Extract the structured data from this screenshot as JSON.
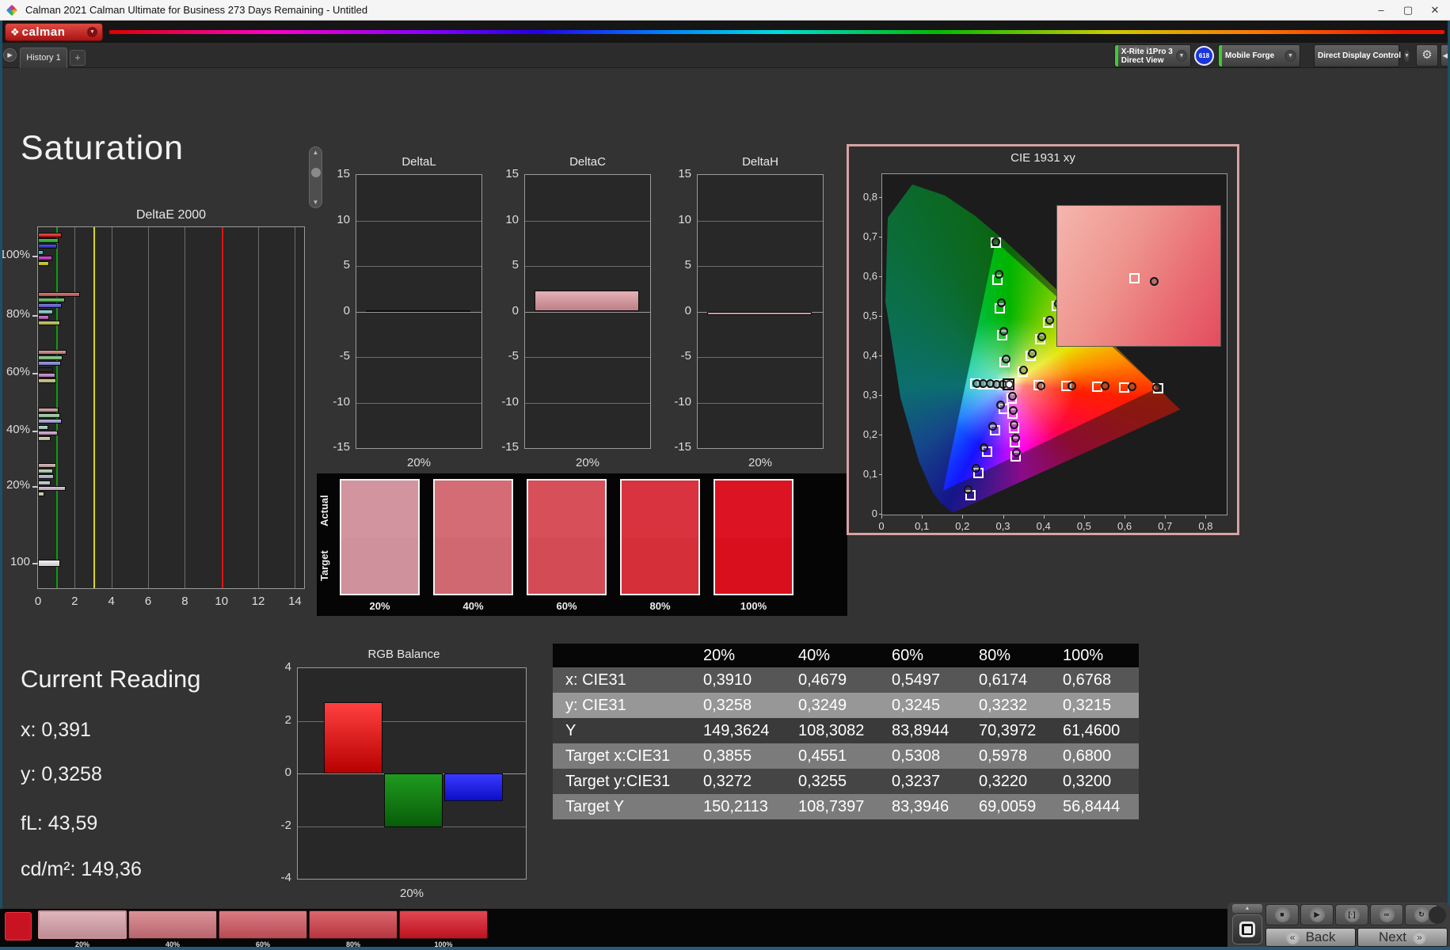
{
  "window": {
    "title": "Calman 2021 Calman Ultimate for Business 273 Days Remaining  - Untitled",
    "minimize": "–",
    "maximize": "▢",
    "close": "✕"
  },
  "brand": {
    "logo_text": "calman",
    "logo_glyph": "❖",
    "dropdown_glyph": "▼"
  },
  "tabs": {
    "history_tab": "History 1",
    "add_tab": "+",
    "play_glyph": "▶"
  },
  "devices": {
    "meter": {
      "line1": "X-Rite i1Pro 3",
      "line2": "Direct View",
      "accent": "#3ecc2e"
    },
    "badge": "618",
    "source": {
      "line1": "Mobile Forge",
      "line2": "",
      "accent": "#3ecc2e"
    },
    "display_control": {
      "line1": "Direct Display Control",
      "line2": "",
      "accent": "#d6d61e"
    },
    "gear_glyph": "⚙",
    "collapse_glyph": "◀"
  },
  "page": {
    "heading": "Saturation"
  },
  "current_reading": {
    "title": "Current Reading",
    "lines": [
      "x: 0,391",
      "y: 0,3258",
      "fL: 43,59",
      "cd/m²: 149,36"
    ]
  },
  "table": {
    "headers": [
      "",
      "20%",
      "40%",
      "60%",
      "80%",
      "100%"
    ],
    "rows": [
      {
        "label": "x: CIE31",
        "values": [
          "0,3910",
          "0,4679",
          "0,5497",
          "0,6174",
          "0,6768"
        ],
        "bg": "#565656"
      },
      {
        "label": "y: CIE31",
        "values": [
          "0,3258",
          "0,3249",
          "0,3245",
          "0,3232",
          "0,3215"
        ],
        "bg": "#979797"
      },
      {
        "label": "Y",
        "values": [
          "149,3624",
          "108,3082",
          "83,8944",
          "70,3972",
          "61,4600"
        ],
        "bg": "#3a3a3a"
      },
      {
        "label": "Target x:CIE31",
        "values": [
          "0,3855",
          "0,4551",
          "0,5308",
          "0,5978",
          "0,6800"
        ],
        "bg": "#7b7b7b"
      },
      {
        "label": "Target y:CIE31",
        "values": [
          "0,3272",
          "0,3255",
          "0,3237",
          "0,3220",
          "0,3200"
        ],
        "bg": "#454545"
      },
      {
        "label": "Target Y",
        "values": [
          "150,2113",
          "108,7397",
          "83,3946",
          "69,0059",
          "56,8444"
        ],
        "bg": "#7b7b7b"
      }
    ]
  },
  "swatches": {
    "actual_label": "Actual",
    "target_label": "Target",
    "labels": [
      "20%",
      "40%",
      "60%",
      "80%",
      "100%"
    ],
    "actual_colors": [
      "#d2959f",
      "#d36c75",
      "#d64f59",
      "#d8333e",
      "#dc1322"
    ],
    "target_colors": [
      "#cf919b",
      "#d06871",
      "#d34b55",
      "#d52f3a",
      "#d90f1e"
    ]
  },
  "bottom": {
    "chip_color": "#c81422",
    "thumb_labels": [
      "20%",
      "40%",
      "60%",
      "80%",
      "100%"
    ],
    "thumb_colors": [
      "#d8a0a9",
      "#d2737c",
      "#d05660",
      "#d03c46",
      "#d91423"
    ],
    "transport": {
      "up_glyph": "▲",
      "icons": [
        {
          "name": "stop-icon",
          "glyph": "■"
        },
        {
          "name": "play-icon",
          "glyph": "▶"
        },
        {
          "name": "interval-icon",
          "glyph": "[·]"
        },
        {
          "name": "continuous-icon",
          "glyph": "∞"
        },
        {
          "name": "refresh-icon",
          "glyph": "↻"
        }
      ],
      "back_label": "Back",
      "back_glyph": "«",
      "next_label": "Next",
      "next_glyph": "»"
    }
  },
  "chart_data": [
    {
      "id": "deltae2000",
      "type": "bar",
      "orientation": "horizontal",
      "title": "DeltaE 2000",
      "xticks": [
        0,
        2,
        4,
        6,
        8,
        10,
        12,
        14
      ],
      "xlim": [
        0,
        14.5
      ],
      "reference_lines": [
        {
          "value": 1,
          "color": "#0c9c0c"
        },
        {
          "value": 3,
          "color": "#d8d812"
        },
        {
          "value": 10,
          "color": "#e01010"
        }
      ],
      "groups": [
        {
          "label": "100%",
          "values": [
            1.3,
            1.12,
            1.02,
            0.29,
            0.76,
            0.61
          ],
          "colors": [
            "#e31b1b",
            "#1faf1f",
            "#2525dd",
            "#25c8c8",
            "#c623c6",
            "#c8c81e"
          ]
        },
        {
          "label": "80%",
          "values": [
            2.29,
            1.46,
            1.3,
            0.83,
            0.61,
            1.2
          ],
          "colors": [
            "#cf5555",
            "#52b852",
            "#5a5ad2",
            "#7cc8c8",
            "#bb5cbb",
            "#bcbc52"
          ]
        },
        {
          "label": "60%",
          "values": [
            1.56,
            1.34,
            1.24,
            0.83,
            0.93,
            0.98
          ],
          "colors": [
            "#cc7d7d",
            "#7fc47f",
            "#8585d0",
            "#96cccа",
            "#c484c4",
            "#c6c67e"
          ]
        },
        {
          "label": "40%",
          "values": [
            1.12,
            1.2,
            1.31,
            0.54,
            1.08,
            0.69
          ],
          "colors": [
            "#c99595",
            "#9ecb9e",
            "#a2a2d4",
            "#a8d0ce",
            "#c9a0c9",
            "#cdcd9c"
          ]
        },
        {
          "label": "20%",
          "values": [
            0.98,
            0.83,
            0.86,
            0.69,
            1.52,
            0.35
          ],
          "colors": [
            "#c9a8a8",
            "#b2ceb2",
            "#b4b4d6",
            "#b6d2d2",
            "#cfb4cf",
            "#d2d2b0"
          ]
        },
        {
          "label": "100",
          "values": [
            1.2
          ],
          "colors": [
            "#ececec"
          ]
        }
      ]
    },
    {
      "id": "deltaL",
      "type": "bar",
      "title": "DeltaL",
      "categories": [
        "20%"
      ],
      "values": [
        0.05
      ],
      "bar_color": "#111111",
      "ylim": [
        -15,
        15
      ],
      "yticks": [
        15,
        10,
        5,
        0,
        -5,
        -10,
        -15
      ]
    },
    {
      "id": "deltaC",
      "type": "bar",
      "title": "DeltaC",
      "categories": [
        "20%"
      ],
      "values": [
        2.3
      ],
      "bar_color": "#d89098",
      "ylim": [
        -15,
        15
      ],
      "yticks": [
        15,
        10,
        5,
        0,
        -5,
        -10,
        -15
      ]
    },
    {
      "id": "deltaH",
      "type": "bar",
      "title": "DeltaH",
      "categories": [
        "20%"
      ],
      "values": [
        -0.35
      ],
      "bar_color": "#d89098",
      "ylim": [
        -15,
        15
      ],
      "yticks": [
        15,
        10,
        5,
        0,
        -5,
        -10,
        -15
      ]
    },
    {
      "id": "cie",
      "type": "scatter",
      "title": "CIE 1931 xy",
      "xlim": [
        0,
        0.85
      ],
      "ylim": [
        0,
        0.86
      ],
      "xticks": [
        "0",
        "0,1",
        "0,2",
        "0,3",
        "0,4",
        "0,5",
        "0,6",
        "0,7",
        "0,8"
      ],
      "yticks": [
        "0,8",
        "0,7",
        "0,6",
        "0,5",
        "0,4",
        "0,3",
        "0,2",
        "0,1",
        "0"
      ],
      "white_point": [
        0.3127,
        0.329
      ],
      "triangle": [
        [
          0.68,
          0.32
        ],
        [
          0.28,
          0.69
        ],
        [
          0.15,
          0.06
        ]
      ],
      "locus": [
        [
          0.1741,
          0.005
        ],
        [
          0.144,
          0.0297
        ],
        [
          0.1241,
          0.0578
        ],
        [
          0.0913,
          0.1327
        ],
        [
          0.0454,
          0.295
        ],
        [
          0.0082,
          0.5384
        ],
        [
          0.0139,
          0.7502
        ],
        [
          0.0743,
          0.8338
        ],
        [
          0.1547,
          0.8059
        ],
        [
          0.2296,
          0.7543
        ],
        [
          0.3016,
          0.6923
        ],
        [
          0.3731,
          0.6245
        ],
        [
          0.4441,
          0.5547
        ],
        [
          0.5125,
          0.4866
        ],
        [
          0.5752,
          0.4242
        ],
        [
          0.627,
          0.3725
        ],
        [
          0.6915,
          0.3083
        ],
        [
          0.7347,
          0.2653
        ]
      ],
      "sweeps": [
        {
          "name": "red",
          "measured": [
            [
              0.391,
              0.3258
            ],
            [
              0.4679,
              0.3249
            ],
            [
              0.5497,
              0.3245
            ],
            [
              0.6174,
              0.3232
            ],
            [
              0.6768,
              0.3215
            ]
          ],
          "target": [
            [
              0.3855,
              0.3272
            ],
            [
              0.4551,
              0.3255
            ],
            [
              0.5308,
              0.3237
            ],
            [
              0.5978,
              0.322
            ],
            [
              0.68,
              0.32
            ]
          ]
        },
        {
          "name": "green",
          "measured": [
            [
              0.306,
              0.393
            ],
            [
              0.3,
              0.463
            ],
            [
              0.294,
              0.535
            ],
            [
              0.288,
              0.608
            ],
            [
              0.28,
              0.69
            ]
          ],
          "target": [
            [
              0.302,
              0.385
            ],
            [
              0.296,
              0.453
            ],
            [
              0.29,
              0.522
            ],
            [
              0.284,
              0.594
            ],
            [
              0.28,
              0.687
            ]
          ]
        },
        {
          "name": "blue",
          "measured": [
            [
              0.293,
              0.277
            ],
            [
              0.272,
              0.224
            ],
            [
              0.252,
              0.17
            ],
            [
              0.232,
              0.117
            ],
            [
              0.212,
              0.064
            ]
          ],
          "target": [
            [
              0.299,
              0.268
            ],
            [
              0.278,
              0.213
            ],
            [
              0.258,
              0.159
            ],
            [
              0.238,
              0.106
            ],
            [
              0.218,
              0.05
            ]
          ]
        },
        {
          "name": "cyan",
          "measured": [
            [
              0.298,
              0.33
            ],
            [
              0.282,
              0.33
            ],
            [
              0.266,
              0.3305
            ],
            [
              0.25,
              0.331
            ],
            [
              0.233,
              0.3315
            ]
          ],
          "target": [
            [
              0.296,
              0.329
            ],
            [
              0.28,
              0.329
            ],
            [
              0.264,
              0.3295
            ],
            [
              0.248,
              0.33
            ],
            [
              0.229,
              0.3305
            ]
          ]
        },
        {
          "name": "magenta",
          "measured": [
            [
              0.321,
              0.3
            ],
            [
              0.3235,
              0.264
            ],
            [
              0.326,
              0.228
            ],
            [
              0.3285,
              0.193
            ],
            [
              0.331,
              0.157
            ]
          ],
          "target": [
            [
              0.3195,
              0.293
            ],
            [
              0.322,
              0.256
            ],
            [
              0.3245,
              0.22
            ],
            [
              0.327,
              0.184
            ],
            [
              0.3295,
              0.148
            ]
          ]
        },
        {
          "name": "yellow",
          "measured": [
            [
              0.3495,
              0.366
            ],
            [
              0.3705,
              0.407
            ],
            [
              0.393,
              0.45
            ],
            [
              0.414,
              0.491
            ],
            [
              0.435,
              0.533
            ]
          ],
          "target": [
            [
              0.346,
              0.362
            ],
            [
              0.367,
              0.402
            ],
            [
              0.389,
              0.444
            ],
            [
              0.41,
              0.485
            ],
            [
              0.431,
              0.527
            ]
          ]
        }
      ]
    },
    {
      "id": "rgb_balance",
      "type": "bar",
      "title": "RGB Balance",
      "categories": [
        "20%"
      ],
      "ylim": [
        -4,
        4
      ],
      "yticks": [
        4,
        2,
        0,
        -2,
        -4
      ],
      "series": [
        {
          "name": "Red",
          "value": 2.7,
          "color_top": "#ff4040",
          "color_bot": "#b80000"
        },
        {
          "name": "Green",
          "value": -2.05,
          "color_top": "#1f9a1f",
          "color_bot": "#085c08"
        },
        {
          "name": "Blue",
          "value": -1.05,
          "color_top": "#3a3aff",
          "color_bot": "#0d0dc8"
        }
      ]
    }
  ]
}
